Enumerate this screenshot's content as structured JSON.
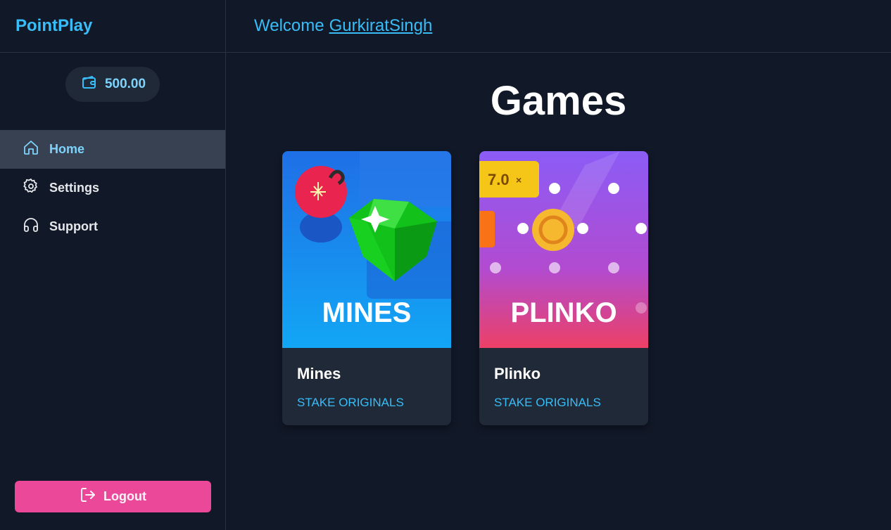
{
  "app": {
    "brand": "PointPlay"
  },
  "header": {
    "welcome": "Welcome",
    "username": "GurkiratSingh"
  },
  "wallet": {
    "balance": "500.00",
    "icon": "wallet-icon"
  },
  "sidebar": {
    "items": [
      {
        "label": "Home",
        "icon": "home-icon",
        "active": true
      },
      {
        "label": "Settings",
        "icon": "gear-icon",
        "active": false
      },
      {
        "label": "Support",
        "icon": "headphones-icon",
        "active": false
      }
    ],
    "logout_label": "Logout"
  },
  "main": {
    "title": "Games",
    "games": [
      {
        "name": "Mines",
        "category": "STAKE ORIGINALS",
        "thumb_text": "MINES"
      },
      {
        "name": "Plinko",
        "category": "STAKE ORIGINALS",
        "thumb_text": "PLINKO",
        "multiplier": "7.0"
      }
    ]
  },
  "colors": {
    "accent": "#38bdf8",
    "logout": "#ec4899",
    "bg": "#111827",
    "card": "#1f2937",
    "active": "#374151"
  }
}
